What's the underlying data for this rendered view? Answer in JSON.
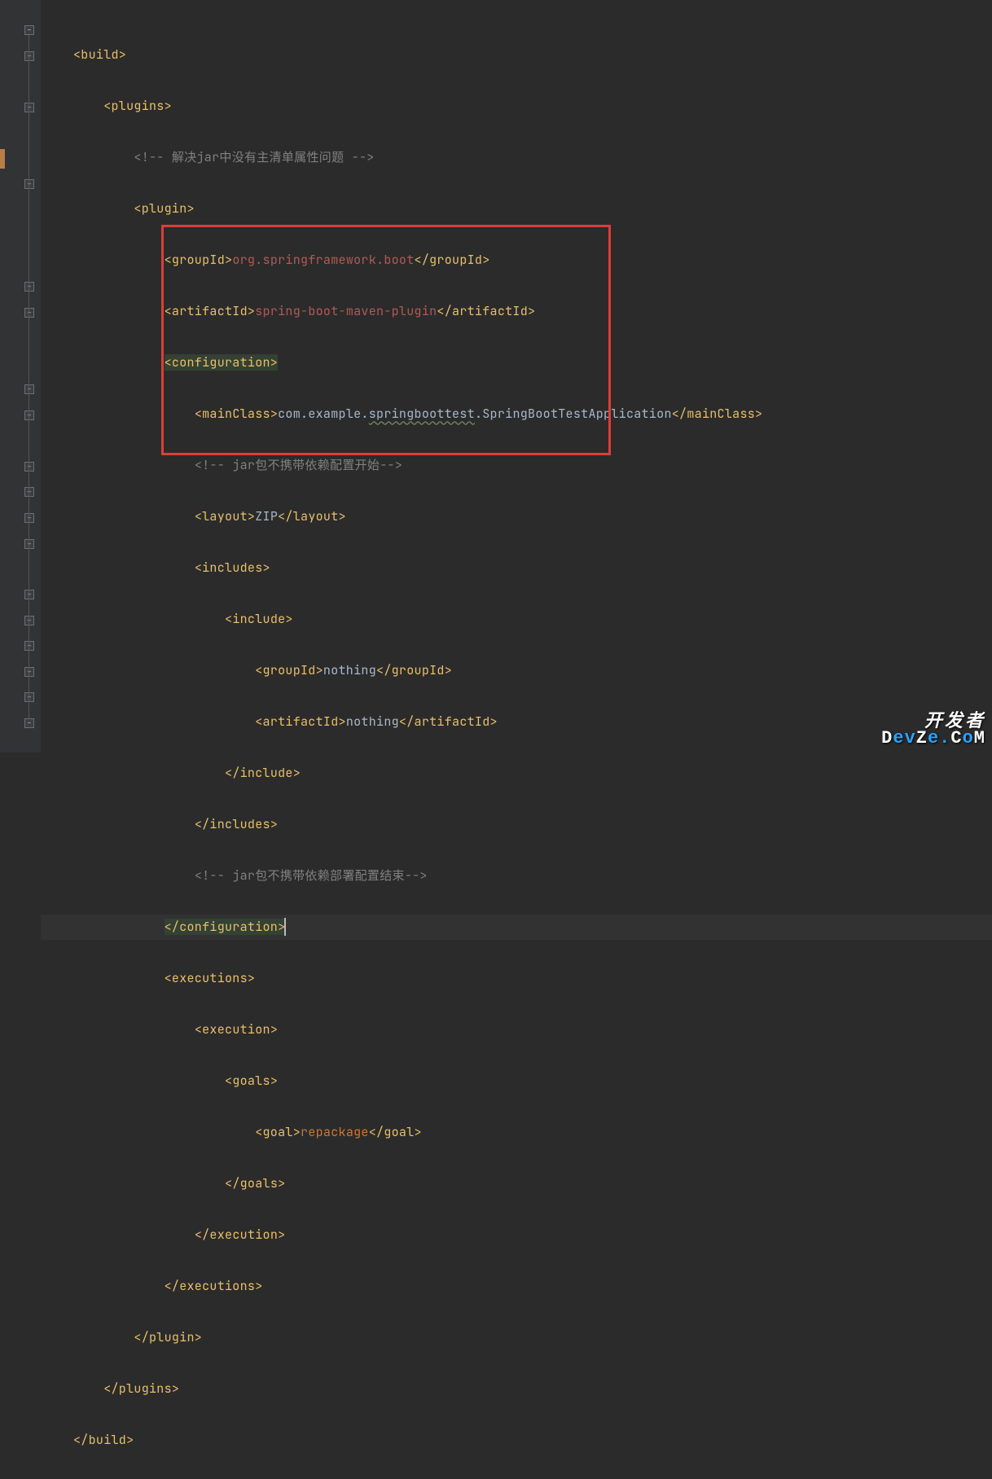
{
  "code": {
    "build_open": "<build>",
    "plugins_open": "<plugins>",
    "comment1": "<!-- 解决jar中没有主清单属性问题 -->",
    "plugin_open": "<plugin>",
    "groupId_open": "<groupId>",
    "groupId_val": "org.springframework.boot",
    "groupId_close": "</groupId>",
    "artifactId_open": "<artifactId>",
    "artifactId_val": "spring-boot-maven-plugin",
    "artifactId_close": "</artifactId>",
    "configuration_open": "<configuration>",
    "mainClass_open": "<mainClass>",
    "mainClass_pkg": "com.example.",
    "mainClass_underlined": "springboottest",
    "mainClass_rest": ".SpringBootTestApplication",
    "mainClass_close": "</mainClass>",
    "comment2": "<!-- jar包不携带依赖配置开始-->",
    "layout_open": "<layout>",
    "layout_val": "ZIP",
    "layout_close": "</layout>",
    "includes_open": "<includes>",
    "include_open": "<include>",
    "inc_groupId_open": "<groupId>",
    "inc_groupId_val": "nothing",
    "inc_groupId_close": "</groupId>",
    "inc_artifactId_open": "<artifactId>",
    "inc_artifactId_val": "nothing",
    "inc_artifactId_close": "</artifactId>",
    "include_close": "</include>",
    "includes_close": "</includes>",
    "comment3": "<!-- jar包不携带依赖部署配置结束-->",
    "configuration_close": "</configuration>",
    "executions_open": "<executions>",
    "execution_open": "<execution>",
    "goals_open": "<goals>",
    "goal_open": "<goal>",
    "goal_val": "repackage",
    "goal_close": "</goal>",
    "goals_close": "</goals>",
    "execution_close": "</execution>",
    "executions_close": "</executions>",
    "plugin_close": "</plugin>",
    "plugins_close": "</plugins>",
    "build_close": "</build>"
  },
  "watermark": {
    "line1": "开发者",
    "line2_a": "D",
    "line2_b": "ev",
    "line2_c": "Z",
    "line2_d": "e.",
    "line2_e": "C",
    "line2_f": "o",
    "line2_g": "M"
  }
}
